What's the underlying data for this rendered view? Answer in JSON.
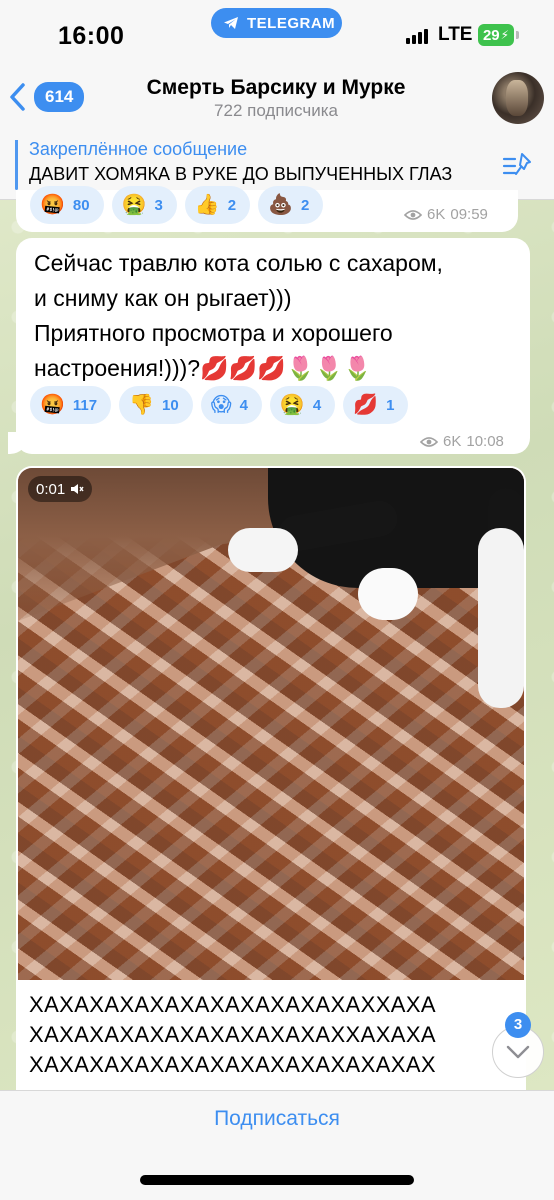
{
  "status_bar": {
    "time": "16:00",
    "app_pill": "TELEGRAM",
    "network": "LTE",
    "battery": "29"
  },
  "header": {
    "back_count": "614",
    "title": "Смерть Барсику и Мурке",
    "subtitle": "722 подписчика"
  },
  "pinned": {
    "title": "Закреплённое сообщение",
    "text": "ДАВИТ ХОМЯКА В РУКЕ ДО ВЫПУЧЕННЫХ ГЛАЗ"
  },
  "messages": [
    {
      "reactions": [
        {
          "emoji": "🤬",
          "count": "80"
        },
        {
          "emoji": "🤮",
          "count": "3"
        },
        {
          "emoji": "👍",
          "count": "2"
        },
        {
          "emoji": "💩",
          "count": "2"
        }
      ],
      "views": "6K",
      "time": "09:59"
    },
    {
      "text_lines": [
        "Сейчас травлю кота солью с сахаром,",
        "и сниму как он рыгает)))",
        "Приятного просмотра и хорошего",
        "настроения!)))?💋💋💋🌷🌷🌷"
      ],
      "reactions": [
        {
          "emoji": "🤬",
          "count": "117"
        },
        {
          "emoji": "👎",
          "count": "10"
        },
        {
          "emoji": "😱",
          "count": "4"
        },
        {
          "emoji": "🤮",
          "count": "4"
        },
        {
          "emoji": "💋",
          "count": "1"
        }
      ],
      "views": "6K",
      "time": "10:08"
    },
    {
      "video_time": "0:01",
      "text_lines": [
        "ХАХАХАХАХАХАХАХАХАХАХАХХАХА",
        "ХАХАХАХАХАХАХАХАХАХАХХАХАХА",
        "ХАХАХАХАХАХАХАХАХАХАХАХАХАХ"
      ]
    }
  ],
  "scroll_badge": "3",
  "bottom": {
    "subscribe_label": "Подписаться"
  },
  "colors": {
    "accent": "#3d8ef0",
    "battery": "#3ec24d",
    "reaction_bg": "#e3effc"
  }
}
